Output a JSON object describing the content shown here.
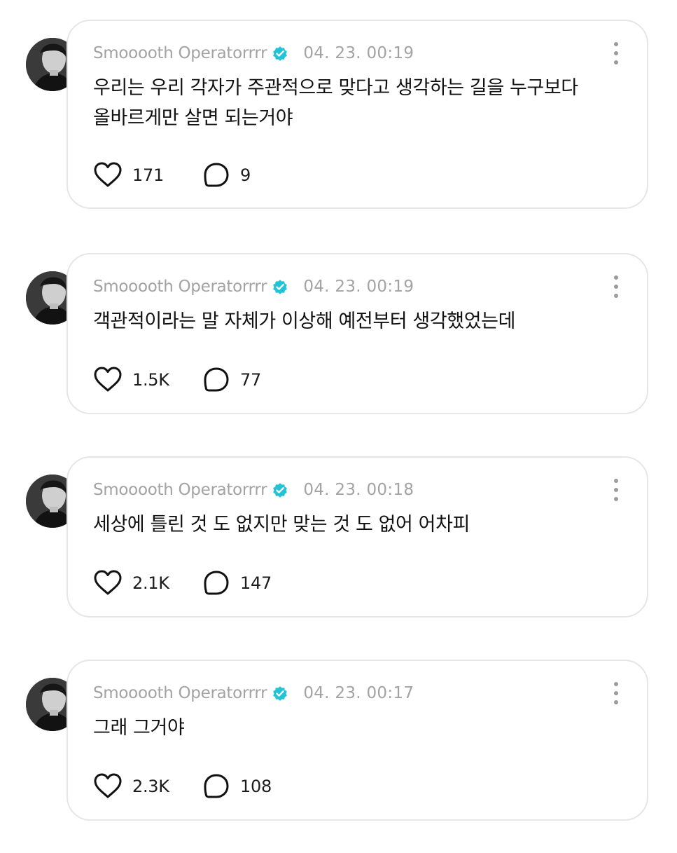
{
  "posts": [
    {
      "author": "Smooooth Operatorrrr",
      "time": "04. 23. 00:19",
      "text": [
        "우리는 우리 각자가 주관적으로 맞다고 생각하는 길을 누구보다",
        "올바르게만 살면 되는거야"
      ],
      "likes": "171",
      "comments": "9"
    },
    {
      "author": "Smooooth Operatorrrr",
      "time": "04. 23. 00:19",
      "text": [
        "객관적이라는 말 자체가 이상해 예전부터 생각했었는데"
      ],
      "likes": "1.5K",
      "comments": "77"
    },
    {
      "author": "Smooooth Operatorrrr",
      "time": "04. 23. 00:18",
      "text": [
        "세상에 틀린 것 도 없지만 맞는 것 도 없어 어차피"
      ],
      "likes": "2.1K",
      "comments": "147"
    },
    {
      "author": "Smooooth Operatorrrr",
      "time": "04. 23. 00:17",
      "text": [
        "그래 그거야"
      ],
      "likes": "2.3K",
      "comments": "108"
    }
  ],
  "icons": {
    "verified": "verified-badge-icon",
    "more": "more-vertical-icon",
    "like": "heart-icon",
    "comment": "comment-bubble-icon"
  },
  "colors": {
    "verified": "#22c3d6",
    "meta": "#a3a3a3",
    "card_border": "#e6e6e6",
    "text": "#111111"
  }
}
